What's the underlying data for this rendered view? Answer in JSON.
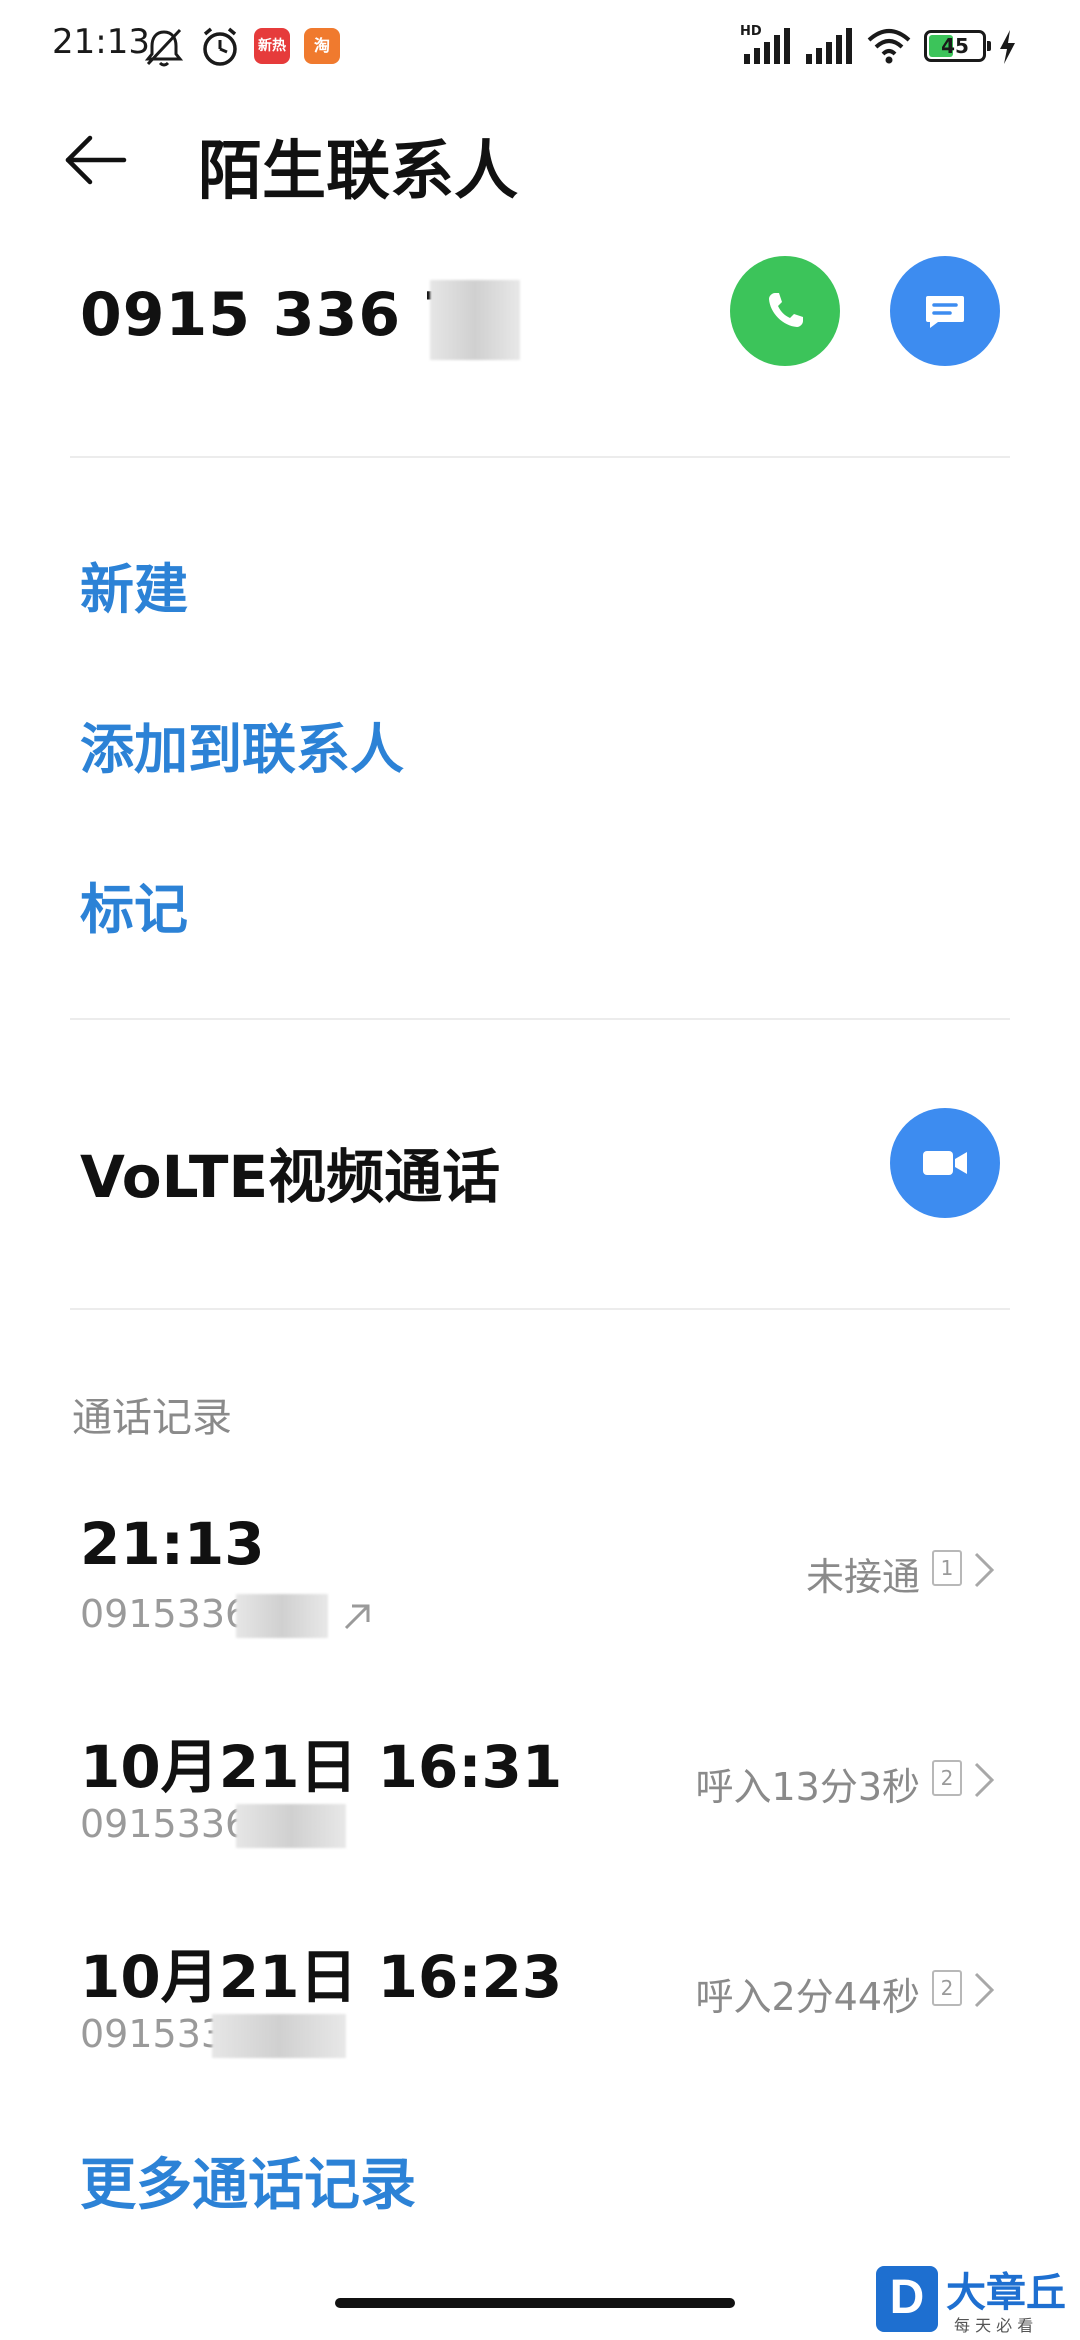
{
  "status_bar": {
    "time": "21:13",
    "notif_badge_1": "新热",
    "notif_badge_2": "淘",
    "signal_hd_label": "HD",
    "battery_level": "45"
  },
  "appbar": {
    "title": "陌生联系人"
  },
  "contact": {
    "phone_number_visible": "0915 336 71"
  },
  "actions": {
    "new_label": "新建",
    "add_to_contacts_label": "添加到联系人",
    "mark_label": "标记"
  },
  "volte": {
    "label": "VoLTE视频通话"
  },
  "call_log": {
    "header": "通话记录",
    "entries": [
      {
        "time": "21:13",
        "number": "0915336",
        "status": "未接通",
        "sim": "1"
      },
      {
        "time": "10月21日 16:31",
        "number": "0915336",
        "status": "呼入13分3秒",
        "sim": "2"
      },
      {
        "time": "10月21日 16:23",
        "number": "091533",
        "status": "呼入2分44秒",
        "sim": "2"
      }
    ],
    "more_label": "更多通话记录"
  },
  "watermark": {
    "letter": "D",
    "name": "大章丘",
    "slogan": "每 天 必 看"
  },
  "colors": {
    "link_blue": "#2c82d6",
    "call_green": "#3cc45a",
    "message_blue": "#3d8cf0",
    "video_blue": "#3d8cf0"
  }
}
